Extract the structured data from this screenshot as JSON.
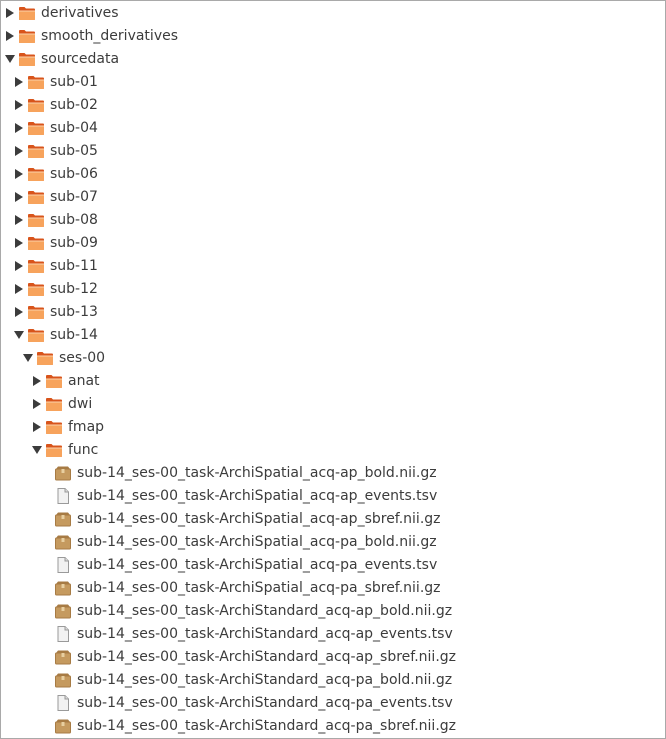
{
  "tree": [
    {
      "label": "derivatives",
      "depth": 0,
      "type": "folder",
      "state": "collapsed"
    },
    {
      "label": "smooth_derivatives",
      "depth": 0,
      "type": "folder",
      "state": "collapsed"
    },
    {
      "label": "sourcedata",
      "depth": 0,
      "type": "folder",
      "state": "expanded"
    },
    {
      "label": "sub-01",
      "depth": 1,
      "type": "folder",
      "state": "collapsed"
    },
    {
      "label": "sub-02",
      "depth": 1,
      "type": "folder",
      "state": "collapsed"
    },
    {
      "label": "sub-04",
      "depth": 1,
      "type": "folder",
      "state": "collapsed"
    },
    {
      "label": "sub-05",
      "depth": 1,
      "type": "folder",
      "state": "collapsed"
    },
    {
      "label": "sub-06",
      "depth": 1,
      "type": "folder",
      "state": "collapsed"
    },
    {
      "label": "sub-07",
      "depth": 1,
      "type": "folder",
      "state": "collapsed"
    },
    {
      "label": "sub-08",
      "depth": 1,
      "type": "folder",
      "state": "collapsed"
    },
    {
      "label": "sub-09",
      "depth": 1,
      "type": "folder",
      "state": "collapsed"
    },
    {
      "label": "sub-11",
      "depth": 1,
      "type": "folder",
      "state": "collapsed"
    },
    {
      "label": "sub-12",
      "depth": 1,
      "type": "folder",
      "state": "collapsed"
    },
    {
      "label": "sub-13",
      "depth": 1,
      "type": "folder",
      "state": "collapsed"
    },
    {
      "label": "sub-14",
      "depth": 1,
      "type": "folder",
      "state": "expanded"
    },
    {
      "label": "ses-00",
      "depth": 2,
      "type": "folder",
      "state": "expanded"
    },
    {
      "label": "anat",
      "depth": 3,
      "type": "folder",
      "state": "collapsed"
    },
    {
      "label": "dwi",
      "depth": 3,
      "type": "folder",
      "state": "collapsed"
    },
    {
      "label": "fmap",
      "depth": 3,
      "type": "folder",
      "state": "collapsed"
    },
    {
      "label": "func",
      "depth": 3,
      "type": "folder",
      "state": "expanded"
    },
    {
      "label": "sub-14_ses-00_task-ArchiSpatial_acq-ap_bold.nii.gz",
      "depth": 4,
      "type": "archive",
      "state": "none"
    },
    {
      "label": "sub-14_ses-00_task-ArchiSpatial_acq-ap_events.tsv",
      "depth": 4,
      "type": "text",
      "state": "none"
    },
    {
      "label": "sub-14_ses-00_task-ArchiSpatial_acq-ap_sbref.nii.gz",
      "depth": 4,
      "type": "archive",
      "state": "none"
    },
    {
      "label": "sub-14_ses-00_task-ArchiSpatial_acq-pa_bold.nii.gz",
      "depth": 4,
      "type": "archive",
      "state": "none"
    },
    {
      "label": "sub-14_ses-00_task-ArchiSpatial_acq-pa_events.tsv",
      "depth": 4,
      "type": "text",
      "state": "none"
    },
    {
      "label": "sub-14_ses-00_task-ArchiSpatial_acq-pa_sbref.nii.gz",
      "depth": 4,
      "type": "archive",
      "state": "none"
    },
    {
      "label": "sub-14_ses-00_task-ArchiStandard_acq-ap_bold.nii.gz",
      "depth": 4,
      "type": "archive",
      "state": "none"
    },
    {
      "label": "sub-14_ses-00_task-ArchiStandard_acq-ap_events.tsv",
      "depth": 4,
      "type": "text",
      "state": "none"
    },
    {
      "label": "sub-14_ses-00_task-ArchiStandard_acq-ap_sbref.nii.gz",
      "depth": 4,
      "type": "archive",
      "state": "none"
    },
    {
      "label": "sub-14_ses-00_task-ArchiStandard_acq-pa_bold.nii.gz",
      "depth": 4,
      "type": "archive",
      "state": "none"
    },
    {
      "label": "sub-14_ses-00_task-ArchiStandard_acq-pa_events.tsv",
      "depth": 4,
      "type": "text",
      "state": "none"
    },
    {
      "label": "sub-14_ses-00_task-ArchiStandard_acq-pa_sbref.nii.gz",
      "depth": 4,
      "type": "archive",
      "state": "none"
    }
  ],
  "icons": {
    "folder": "folder-icon",
    "archive": "archive-file-icon",
    "text": "text-file-icon",
    "collapsed": "triangle-right-icon",
    "expanded": "triangle-down-icon"
  },
  "colors": {
    "folder_light": "#f7a35c",
    "folder_dark": "#d8541b",
    "archive": "#c59a5f",
    "text_file": "#f2f2f2",
    "expander": "#3c3c3c"
  }
}
